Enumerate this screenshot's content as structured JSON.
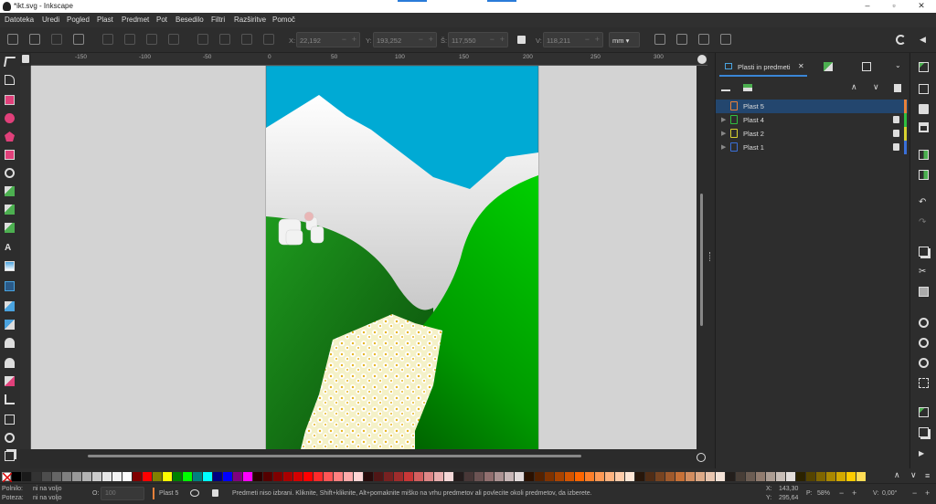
{
  "window": {
    "title": "*ikt.svg - Inkscape"
  },
  "menu": [
    "Datoteka",
    "Uredi",
    "Pogled",
    "Plast",
    "Predmet",
    "Pot",
    "Besedilo",
    "Filtri",
    "Razširitve",
    "Pomoč"
  ],
  "toolbar": {
    "x_label": "X:",
    "x_value": "22,192",
    "y_label": "Y:",
    "y_value": "193,252",
    "w_label": "Š:",
    "w_value": "117,550",
    "h_label": "V:",
    "h_value": "118,211",
    "unit": "mm"
  },
  "ruler_ticks": [
    "-150",
    "-100",
    "-50",
    "0",
    "50",
    "100",
    "150",
    "200",
    "250",
    "300"
  ],
  "dock": {
    "tab_label": "Plasti in predmeti",
    "layers": [
      {
        "label": "Plast 5",
        "color": "#e8813a",
        "doc_color": "#e8813a",
        "locked": false,
        "selected": true
      },
      {
        "label": "Plast 4",
        "color": "#2fbf3f",
        "doc_color": "#2fbf3f",
        "locked": true,
        "selected": false
      },
      {
        "label": "Plast 2",
        "color": "#d8d230",
        "doc_color": "#d8d230",
        "locked": true,
        "selected": false
      },
      {
        "label": "Plast 1",
        "color": "#3a6fd8",
        "doc_color": "#3a6fd8",
        "locked": true,
        "selected": false
      }
    ]
  },
  "status": {
    "fill_label": "Polnilo:",
    "fill_value": "ni na voljo",
    "stroke_label": "Poteza:",
    "stroke_value": "ni na voljo",
    "opacity_label": "O:",
    "opacity_value": "100",
    "current_layer": "Plast 5",
    "message": "Predmeti niso izbrani. Kliknite, Shift+kliknite, Alt+pomaknite miško na vrhu predmetov ali povlecite okoli predmetov, da izberete.",
    "cursor_x_label": "X:",
    "cursor_x": "143,30",
    "cursor_y_label": "Y:",
    "cursor_y": "295,64",
    "zoom_label": "P:",
    "zoom": "58%",
    "rotate_label": "V:",
    "rotate": "0,00°"
  },
  "palette_colors": [
    "#000000",
    "#1a1a1a",
    "#333333",
    "#4d4d4d",
    "#666666",
    "#808080",
    "#999999",
    "#b3b3b3",
    "#cccccc",
    "#e6e6e6",
    "#f2f2f2",
    "#ffffff",
    "#800000",
    "#ff0000",
    "#808000",
    "#ffff00",
    "#008000",
    "#00ff00",
    "#008080",
    "#00ffff",
    "#000080",
    "#0000ff",
    "#800080",
    "#ff00ff",
    "#2b0000",
    "#550000",
    "#800000",
    "#aa0000",
    "#d40000",
    "#ff0000",
    "#ff2a2a",
    "#ff5555",
    "#ff8080",
    "#ffaaaa",
    "#ffd5d5",
    "#280b0b",
    "#501616",
    "#782121",
    "#a02c2c",
    "#c83737",
    "#d35f5f",
    "#de8787",
    "#e9afaf",
    "#f4d7d7",
    "#241c1c",
    "#483737",
    "#6c5353",
    "#916f6f",
    "#ac9393",
    "#c8b7b7",
    "#e3dbdb",
    "#2b1100",
    "#552200",
    "#803300",
    "#aa4400",
    "#d45500",
    "#ff6600",
    "#ff7f2a",
    "#ff9955",
    "#ffb380",
    "#ffccaa",
    "#ffe6d5",
    "#28170b",
    "#502d16",
    "#784421",
    "#a05a2c",
    "#c87137",
    "#d38d5f",
    "#deaa87",
    "#e9c6af",
    "#f4e3d7",
    "#241f1c",
    "#483e37",
    "#6c5d53",
    "#917c6f",
    "#ac9d93",
    "#c8beb7",
    "#e3dedb",
    "#2b2200",
    "#554400",
    "#806600",
    "#aa8800",
    "#d4aa00",
    "#ffcc00",
    "#ffdd55"
  ]
}
